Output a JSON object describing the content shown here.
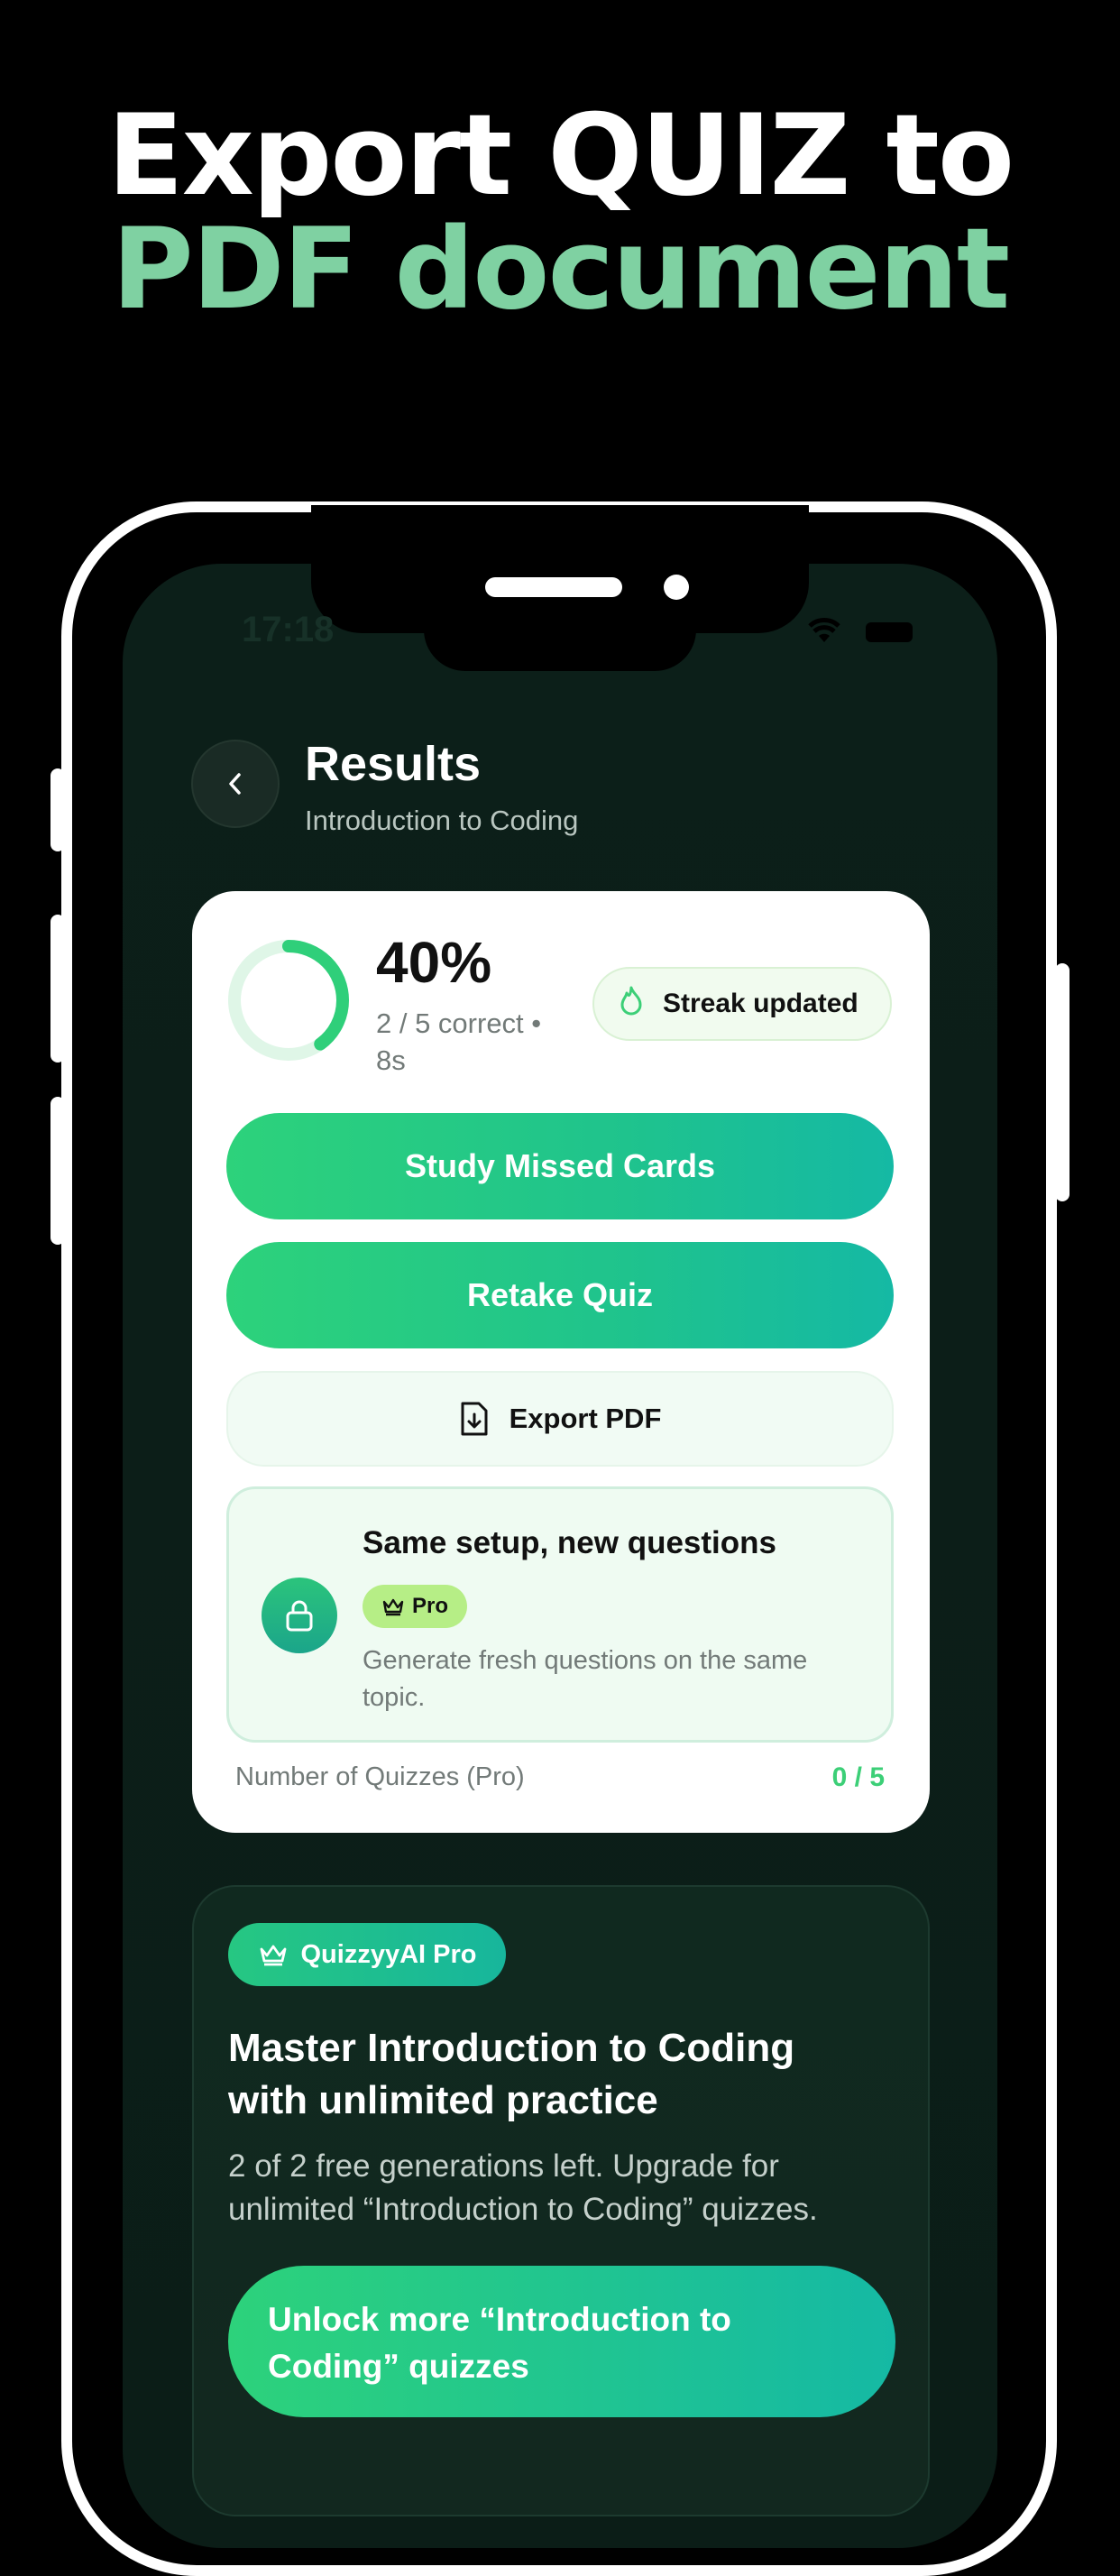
{
  "headline": {
    "line1": "Export QUIZ to",
    "line2": "PDF document"
  },
  "status": {
    "time": "17:18"
  },
  "header": {
    "title": "Results",
    "subtitle": "Introduction to Coding"
  },
  "result": {
    "percent": "40%",
    "percent_value": 0.4,
    "correct": "2 / 5 correct • 8s",
    "streak_label": "Streak updated"
  },
  "actions": {
    "study_missed": "Study Missed Cards",
    "retake": "Retake Quiz",
    "export": "Export PDF"
  },
  "same_setup": {
    "title": "Same setup, new questions",
    "badge": "Pro",
    "description": "Generate fresh questions on the same topic."
  },
  "quiz_count": {
    "label": "Number of Quizzes (Pro)",
    "value": "0 / 5"
  },
  "pro": {
    "badge": "QuizzyyAI Pro",
    "heading": "Master Introduction to Coding with unlimited practice",
    "description": "2 of 2 free generations left. Upgrade for unlimited “Introduction to Coding” quizzes.",
    "cta": "Unlock more “Introduction to Coding” quizzes"
  },
  "colors": {
    "accent": "#2dd27b",
    "accent_teal": "#15b9a4",
    "headline_green": "#7fd1a2",
    "pro_badge": "#b6ee86"
  }
}
